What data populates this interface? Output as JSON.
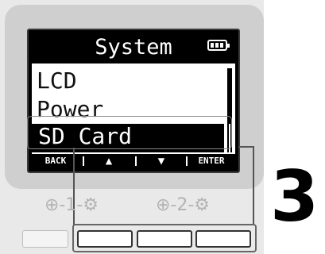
{
  "screen": {
    "title": "System",
    "menu_items": [
      "LCD",
      "Power",
      "SD Card"
    ],
    "selected_index": 2
  },
  "softkeys": {
    "back": "BACK",
    "up": "▲",
    "down": "▼",
    "enter": "ENTER"
  },
  "knobs": {
    "knob1": "⊕-1-⚙",
    "knob2": "⊕-2-⚙"
  },
  "step_number": "3",
  "colors": {
    "screen_bg": "#ffffff",
    "screen_ink": "#000000",
    "bezel": "#cfcfcf",
    "device_body": "#e9e9e9"
  }
}
